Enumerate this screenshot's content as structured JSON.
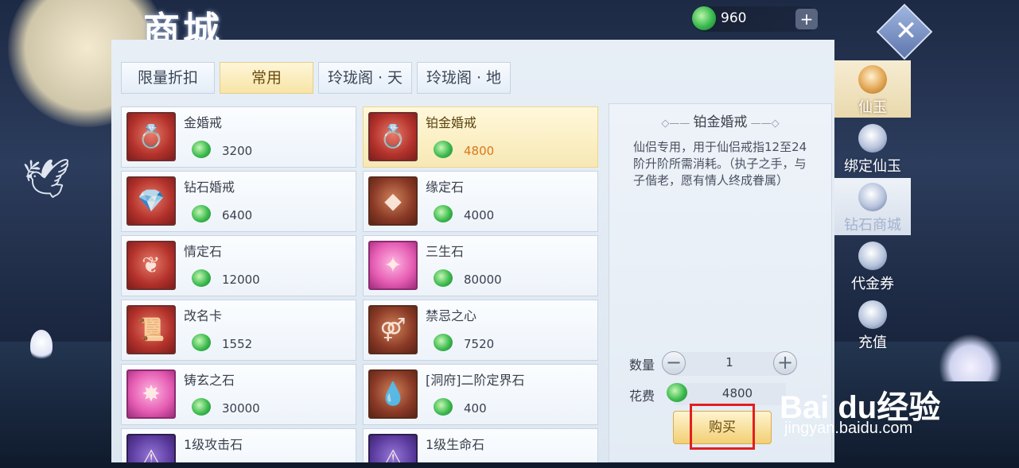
{
  "title": "商城",
  "currency": {
    "value": "960",
    "plus": "+"
  },
  "close": "✕",
  "tabs": [
    "限量折扣",
    "常用",
    "玲珑阁 · 天",
    "玲珑阁 · 地"
  ],
  "active_tab": "常用",
  "items": [
    {
      "name": "金婚戒",
      "price": "3200",
      "icon": "gold-ring-icon",
      "glyph": "💍",
      "style": "red"
    },
    {
      "name": "铂金婚戒",
      "price": "4800",
      "icon": "platinum-ring-icon",
      "glyph": "💍",
      "style": "red",
      "selected": true
    },
    {
      "name": "钻石婚戒",
      "price": "6400",
      "icon": "diamond-ring-icon",
      "glyph": "💎",
      "style": "red"
    },
    {
      "name": "缘定石",
      "price": "4000",
      "icon": "blue-crystal-icon",
      "glyph": "◆",
      "style": "brown"
    },
    {
      "name": "情定石",
      "price": "12000",
      "icon": "red-stone-icon",
      "glyph": "❦",
      "style": "red"
    },
    {
      "name": "三生石",
      "price": "80000",
      "icon": "pink-stone-icon",
      "glyph": "✦",
      "style": "pink"
    },
    {
      "name": "改名卡",
      "price": "1552",
      "icon": "scroll-icon",
      "glyph": "📜",
      "style": "red"
    },
    {
      "name": "禁忌之心",
      "price": "7520",
      "icon": "forbidden-heart-icon",
      "glyph": "⚤",
      "style": "brown"
    },
    {
      "name": "铸玄之石",
      "price": "30000",
      "icon": "forge-stone-icon",
      "glyph": "✸",
      "style": "pink"
    },
    {
      "name": "[洞府]二阶定界石",
      "price": "400",
      "icon": "water-drop-icon",
      "glyph": "💧",
      "style": "brown"
    },
    {
      "name": "1级攻击石",
      "price": "",
      "icon": "attack-stone-icon",
      "glyph": "⚠",
      "style": "purple"
    },
    {
      "name": "1级生命石",
      "price": "",
      "icon": "life-stone-icon",
      "glyph": "⚠",
      "style": "purple"
    }
  ],
  "detail": {
    "title": "铂金婚戒",
    "desc": "仙侣专用，用于仙侣戒指12至24阶升阶所需消耗。（执子之手，与子偕老，愿有情人终成眷属）",
    "qty_label": "数量",
    "qty_value": "1",
    "minus": "−",
    "plus": "+",
    "cost_label": "花费",
    "cost_value": "4800",
    "buy": "购买"
  },
  "side_nav": [
    {
      "label": "仙玉",
      "icon": "jade-coin-icon",
      "state": "active"
    },
    {
      "label": "绑定仙玉",
      "icon": "bound-jade-icon",
      "state": "normal"
    },
    {
      "label": "钻石商城",
      "icon": "shop-house-icon",
      "state": "dim"
    },
    {
      "label": "代金券",
      "icon": "voucher-icon",
      "state": "normal"
    },
    {
      "label": "充值",
      "icon": "recharge-icon",
      "state": "normal"
    }
  ],
  "watermark": {
    "logo": "Bai du经验",
    "url": "jingyan.baidu.com"
  },
  "colors": {
    "highlight": "#e02020",
    "price_selected": "#d9781b"
  }
}
